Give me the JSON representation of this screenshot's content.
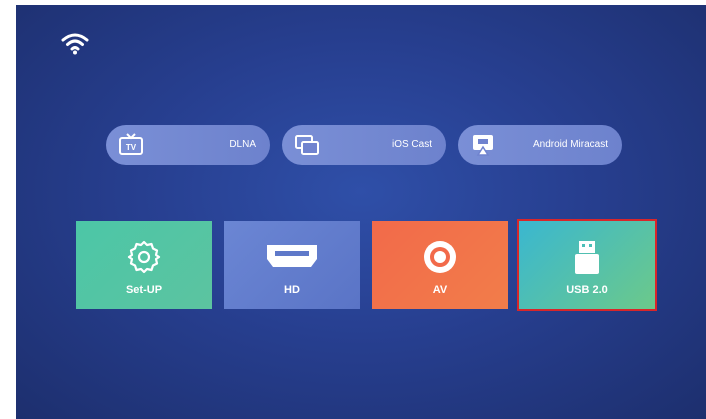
{
  "status": {
    "wifi_icon": "wifi-icon"
  },
  "cast": [
    {
      "label": "DLNA",
      "icon": "tv-icon"
    },
    {
      "label": "iOS Cast",
      "icon": "screen-mirror-icon"
    },
    {
      "label": "Android Miracast",
      "icon": "cast-screen-icon"
    }
  ],
  "sources": [
    {
      "label": "Set-UP",
      "icon": "gear-icon",
      "color": "#4cc6a7"
    },
    {
      "label": "HD",
      "icon": "hdmi-icon",
      "color": "#6b86d4"
    },
    {
      "label": "AV",
      "icon": "av-icon",
      "color": "#f26a4a"
    },
    {
      "label": "USB 2.0",
      "icon": "usb-icon",
      "color": "#3ab7d0",
      "selected": true
    }
  ],
  "colors": {
    "selection_outline": "#d8262a",
    "background": "#273f90"
  }
}
